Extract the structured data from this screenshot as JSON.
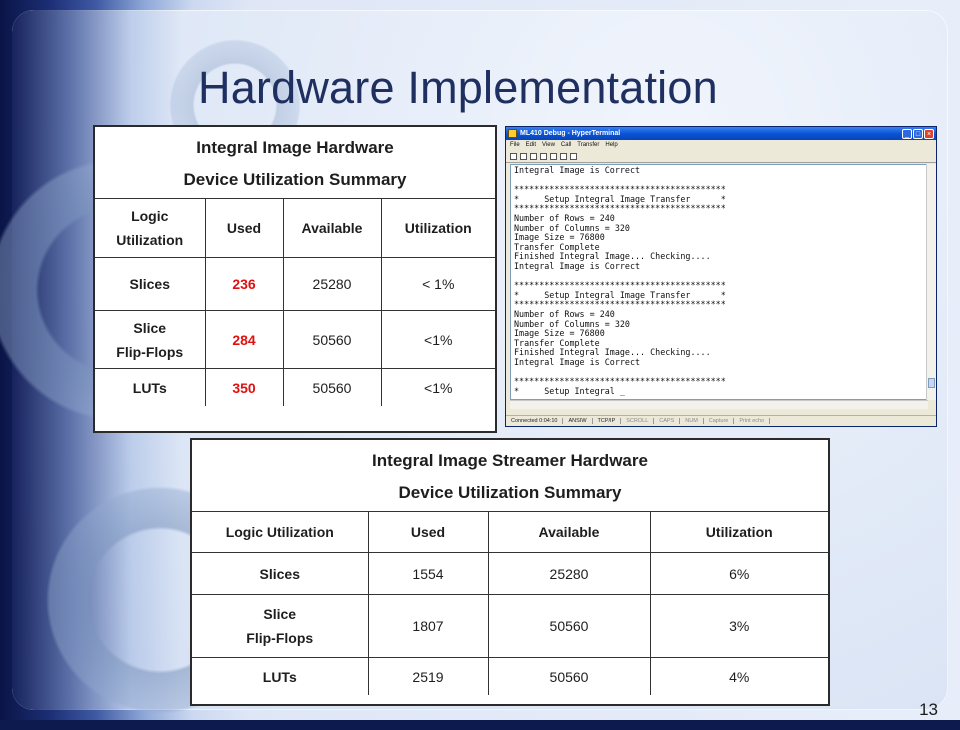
{
  "slide": {
    "title": "Hardware Implementation",
    "page_number": "13"
  },
  "table1": {
    "heading_line1": "Integral Image Hardware",
    "heading_line2": "Device Utilization Summary",
    "columns": [
      "Logic Utilization",
      "Used",
      "Available",
      "Utilization"
    ],
    "rows": [
      {
        "label": "Slices",
        "used": "236",
        "available": "25280",
        "utilization": "< 1%"
      },
      {
        "label_line1": "Slice",
        "label_line2": "Flip-Flops",
        "used": "284",
        "available": "50560",
        "utilization": "<1%"
      },
      {
        "label": "LUTs",
        "used": "350",
        "available": "50560",
        "utilization": "<1%"
      }
    ],
    "used_color": "#e01010"
  },
  "table2": {
    "heading_line1": "Integral Image Streamer Hardware",
    "heading_line2": "Device Utilization Summary",
    "columns": [
      "Logic Utilization",
      "Used",
      "Available",
      "Utilization"
    ],
    "rows": [
      {
        "label": "Slices",
        "used": "1554",
        "available": "25280",
        "utilization": "6%"
      },
      {
        "label_line1": "Slice",
        "label_line2": "Flip-Flops",
        "used": "1807",
        "available": "50560",
        "utilization": "3%"
      },
      {
        "label": "LUTs",
        "used": "2519",
        "available": "50560",
        "utilization": "4%"
      }
    ]
  },
  "terminal": {
    "window_title": "ML410 Debug - HyperTerminal",
    "menu": [
      "File",
      "Edit",
      "View",
      "Call",
      "Transfer",
      "Help"
    ],
    "lines": [
      "Integral Image is Correct",
      "",
      "******************************************",
      "*     Setup Integral Image Transfer      *",
      "******************************************",
      "Number of Rows = 240",
      "Number of Columns = 320",
      "Image Size = 76800",
      "Transfer Complete",
      "Finished Integral Image... Checking....",
      "Integral Image is Correct",
      "",
      "******************************************",
      "*     Setup Integral Image Transfer      *",
      "******************************************",
      "Number of Rows = 240",
      "Number of Columns = 320",
      "Image Size = 76800",
      "Transfer Complete",
      "Finished Integral Image... Checking....",
      "Integral Image is Correct",
      "",
      "******************************************",
      "*     Setup Integral _"
    ],
    "status": {
      "connected": "Connected 0:04:10",
      "emulation": "ANSIW",
      "protocol": "TCP/IP",
      "scroll": "SCROLL",
      "caps": "CAPS",
      "num": "NUM",
      "capture": "Capture",
      "print_echo": "Print echo"
    }
  }
}
